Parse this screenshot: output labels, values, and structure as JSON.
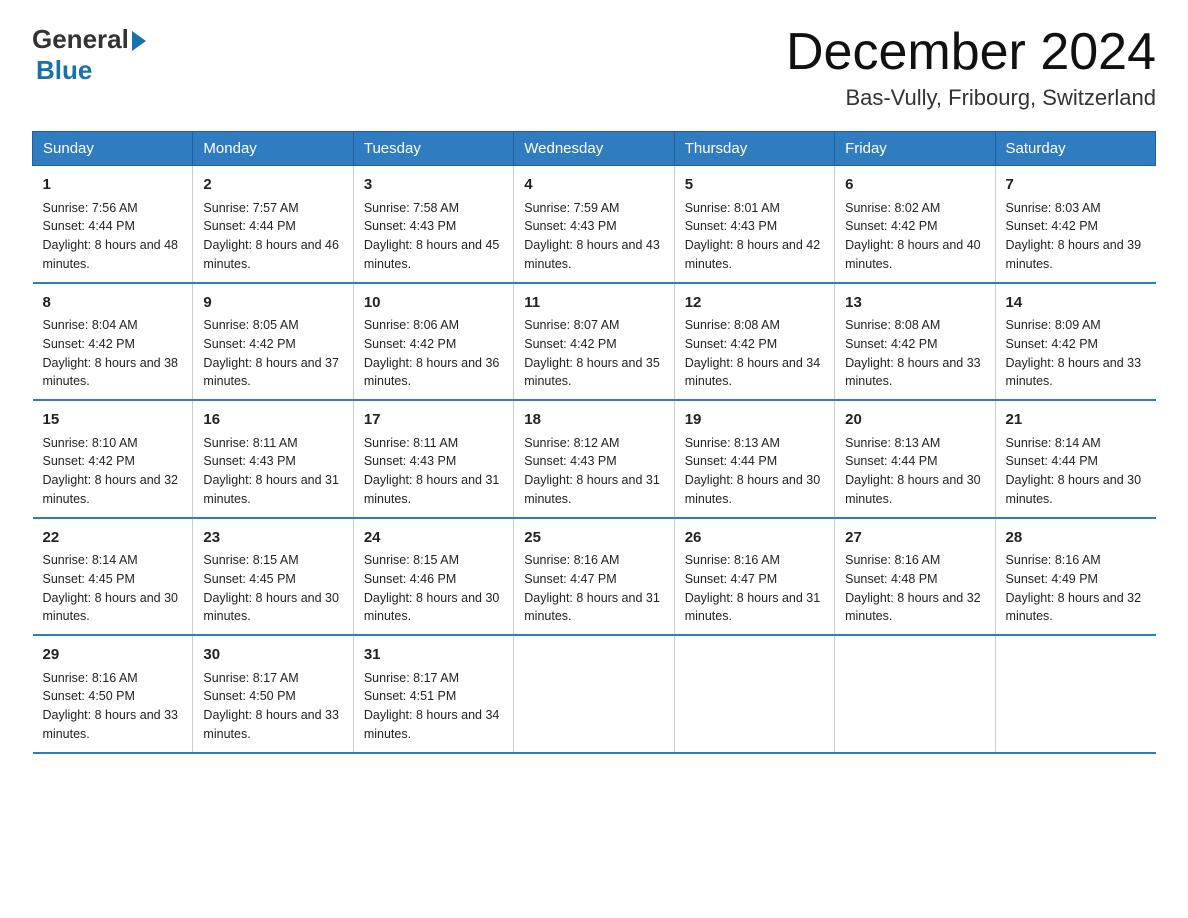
{
  "logo": {
    "general": "General",
    "blue": "Blue"
  },
  "title": "December 2024",
  "location": "Bas-Vully, Fribourg, Switzerland",
  "days_of_week": [
    "Sunday",
    "Monday",
    "Tuesday",
    "Wednesday",
    "Thursday",
    "Friday",
    "Saturday"
  ],
  "weeks": [
    [
      {
        "day": "1",
        "sunrise": "7:56 AM",
        "sunset": "4:44 PM",
        "daylight": "8 hours and 48 minutes."
      },
      {
        "day": "2",
        "sunrise": "7:57 AM",
        "sunset": "4:44 PM",
        "daylight": "8 hours and 46 minutes."
      },
      {
        "day": "3",
        "sunrise": "7:58 AM",
        "sunset": "4:43 PM",
        "daylight": "8 hours and 45 minutes."
      },
      {
        "day": "4",
        "sunrise": "7:59 AM",
        "sunset": "4:43 PM",
        "daylight": "8 hours and 43 minutes."
      },
      {
        "day": "5",
        "sunrise": "8:01 AM",
        "sunset": "4:43 PM",
        "daylight": "8 hours and 42 minutes."
      },
      {
        "day": "6",
        "sunrise": "8:02 AM",
        "sunset": "4:42 PM",
        "daylight": "8 hours and 40 minutes."
      },
      {
        "day": "7",
        "sunrise": "8:03 AM",
        "sunset": "4:42 PM",
        "daylight": "8 hours and 39 minutes."
      }
    ],
    [
      {
        "day": "8",
        "sunrise": "8:04 AM",
        "sunset": "4:42 PM",
        "daylight": "8 hours and 38 minutes."
      },
      {
        "day": "9",
        "sunrise": "8:05 AM",
        "sunset": "4:42 PM",
        "daylight": "8 hours and 37 minutes."
      },
      {
        "day": "10",
        "sunrise": "8:06 AM",
        "sunset": "4:42 PM",
        "daylight": "8 hours and 36 minutes."
      },
      {
        "day": "11",
        "sunrise": "8:07 AM",
        "sunset": "4:42 PM",
        "daylight": "8 hours and 35 minutes."
      },
      {
        "day": "12",
        "sunrise": "8:08 AM",
        "sunset": "4:42 PM",
        "daylight": "8 hours and 34 minutes."
      },
      {
        "day": "13",
        "sunrise": "8:08 AM",
        "sunset": "4:42 PM",
        "daylight": "8 hours and 33 minutes."
      },
      {
        "day": "14",
        "sunrise": "8:09 AM",
        "sunset": "4:42 PM",
        "daylight": "8 hours and 33 minutes."
      }
    ],
    [
      {
        "day": "15",
        "sunrise": "8:10 AM",
        "sunset": "4:42 PM",
        "daylight": "8 hours and 32 minutes."
      },
      {
        "day": "16",
        "sunrise": "8:11 AM",
        "sunset": "4:43 PM",
        "daylight": "8 hours and 31 minutes."
      },
      {
        "day": "17",
        "sunrise": "8:11 AM",
        "sunset": "4:43 PM",
        "daylight": "8 hours and 31 minutes."
      },
      {
        "day": "18",
        "sunrise": "8:12 AM",
        "sunset": "4:43 PM",
        "daylight": "8 hours and 31 minutes."
      },
      {
        "day": "19",
        "sunrise": "8:13 AM",
        "sunset": "4:44 PM",
        "daylight": "8 hours and 30 minutes."
      },
      {
        "day": "20",
        "sunrise": "8:13 AM",
        "sunset": "4:44 PM",
        "daylight": "8 hours and 30 minutes."
      },
      {
        "day": "21",
        "sunrise": "8:14 AM",
        "sunset": "4:44 PM",
        "daylight": "8 hours and 30 minutes."
      }
    ],
    [
      {
        "day": "22",
        "sunrise": "8:14 AM",
        "sunset": "4:45 PM",
        "daylight": "8 hours and 30 minutes."
      },
      {
        "day": "23",
        "sunrise": "8:15 AM",
        "sunset": "4:45 PM",
        "daylight": "8 hours and 30 minutes."
      },
      {
        "day": "24",
        "sunrise": "8:15 AM",
        "sunset": "4:46 PM",
        "daylight": "8 hours and 30 minutes."
      },
      {
        "day": "25",
        "sunrise": "8:16 AM",
        "sunset": "4:47 PM",
        "daylight": "8 hours and 31 minutes."
      },
      {
        "day": "26",
        "sunrise": "8:16 AM",
        "sunset": "4:47 PM",
        "daylight": "8 hours and 31 minutes."
      },
      {
        "day": "27",
        "sunrise": "8:16 AM",
        "sunset": "4:48 PM",
        "daylight": "8 hours and 32 minutes."
      },
      {
        "day": "28",
        "sunrise": "8:16 AM",
        "sunset": "4:49 PM",
        "daylight": "8 hours and 32 minutes."
      }
    ],
    [
      {
        "day": "29",
        "sunrise": "8:16 AM",
        "sunset": "4:50 PM",
        "daylight": "8 hours and 33 minutes."
      },
      {
        "day": "30",
        "sunrise": "8:17 AM",
        "sunset": "4:50 PM",
        "daylight": "8 hours and 33 minutes."
      },
      {
        "day": "31",
        "sunrise": "8:17 AM",
        "sunset": "4:51 PM",
        "daylight": "8 hours and 34 minutes."
      },
      null,
      null,
      null,
      null
    ]
  ]
}
